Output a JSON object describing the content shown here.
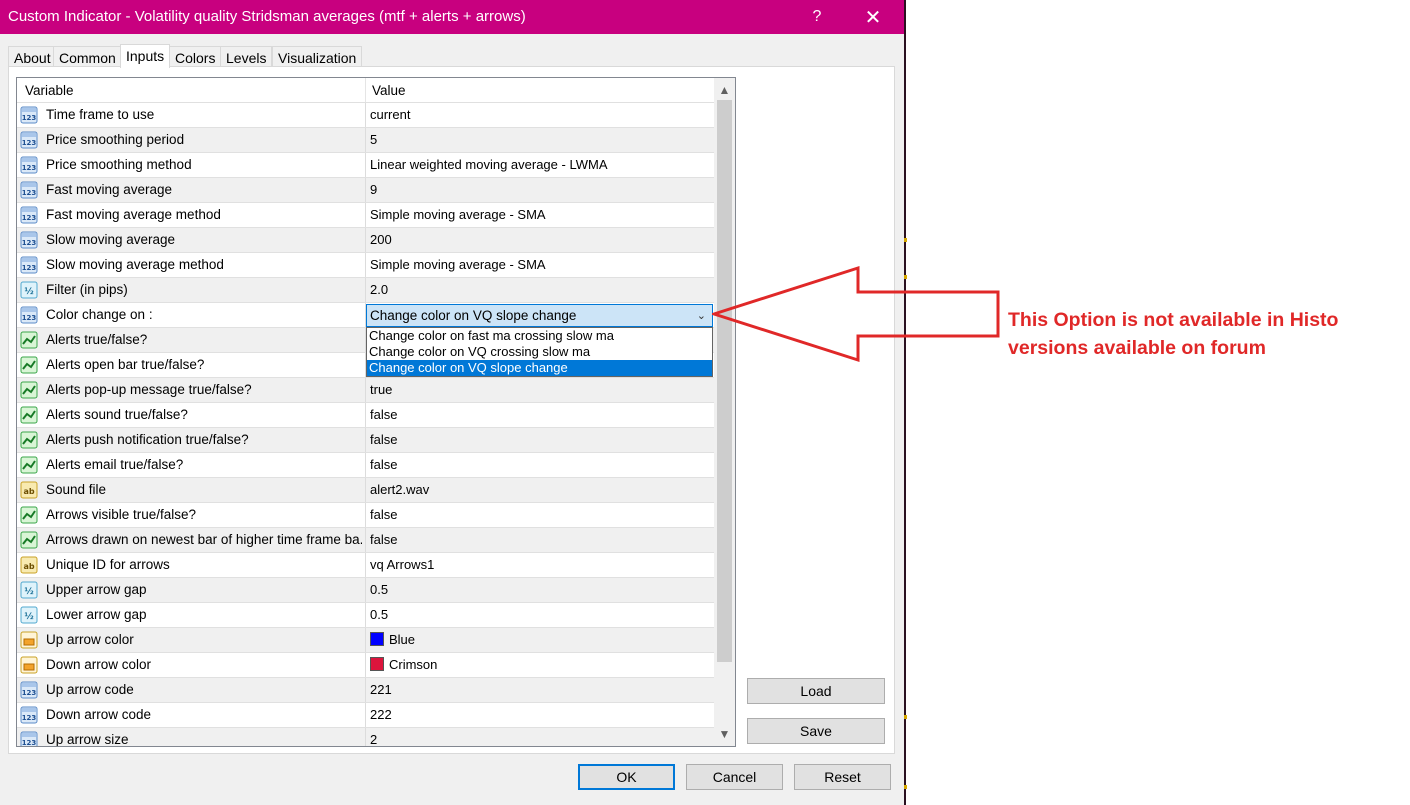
{
  "window": {
    "title": "Custom Indicator - Volatility quality Stridsman  averages (mtf + alerts + arrows)",
    "help_glyph": "?",
    "close_glyph": "✕"
  },
  "tabs": [
    {
      "label": "About"
    },
    {
      "label": "Common"
    },
    {
      "label": "Inputs",
      "active": true
    },
    {
      "label": "Colors"
    },
    {
      "label": "Levels"
    },
    {
      "label": "Visualization"
    }
  ],
  "grid": {
    "header_variable": "Variable",
    "header_value": "Value",
    "rows": [
      {
        "icon": "int-123-icon",
        "variable": "Time frame to use",
        "value": "current"
      },
      {
        "icon": "int-123-icon",
        "variable": "Price smoothing period",
        "value": "5"
      },
      {
        "icon": "int-123-icon",
        "variable": "Price smoothing method",
        "value": "Linear weighted moving average - LWMA"
      },
      {
        "icon": "int-123-icon",
        "variable": "Fast moving average",
        "value": "9"
      },
      {
        "icon": "int-123-icon",
        "variable": "Fast moving average method",
        "value": "Simple moving average - SMA"
      },
      {
        "icon": "int-123-icon",
        "variable": "Slow moving average",
        "value": "200"
      },
      {
        "icon": "int-123-icon",
        "variable": "Slow moving average method",
        "value": "Simple moving average - SMA"
      },
      {
        "icon": "double-half-icon",
        "variable": "Filter (in pips)",
        "value": "2.0"
      },
      {
        "icon": "int-123-icon",
        "variable": "Color change on :",
        "value": "Change color on VQ slope change"
      },
      {
        "icon": "bool-icon",
        "variable": "Alerts true/false?",
        "value": ""
      },
      {
        "icon": "bool-icon",
        "variable": "Alerts open bar true/false?",
        "value": ""
      },
      {
        "icon": "bool-icon",
        "variable": "Alerts pop-up message true/false?",
        "value": "true"
      },
      {
        "icon": "bool-icon",
        "variable": "Alerts sound true/false?",
        "value": "false"
      },
      {
        "icon": "bool-icon",
        "variable": "Alerts push notification true/false?",
        "value": "false"
      },
      {
        "icon": "bool-icon",
        "variable": "Alerts email true/false?",
        "value": "false"
      },
      {
        "icon": "string-ab-icon",
        "variable": "Sound file",
        "value": "alert2.wav"
      },
      {
        "icon": "bool-icon",
        "variable": "Arrows visible true/false?",
        "value": "false"
      },
      {
        "icon": "bool-icon",
        "variable": "Arrows drawn on newest bar of higher time frame ba...",
        "value": "false"
      },
      {
        "icon": "string-ab-icon",
        "variable": "Unique ID for arrows",
        "value": "vq Arrows1"
      },
      {
        "icon": "double-half-icon",
        "variable": "Upper arrow gap",
        "value": "0.5"
      },
      {
        "icon": "double-half-icon",
        "variable": "Lower arrow gap",
        "value": "0.5"
      },
      {
        "icon": "color-icon",
        "variable": "Up arrow color",
        "value": "Blue",
        "swatch": "#0000ff"
      },
      {
        "icon": "color-icon",
        "variable": "Down arrow color",
        "value": "Crimson",
        "swatch": "#dc143c"
      },
      {
        "icon": "int-123-icon",
        "variable": "Up arrow code",
        "value": "221"
      },
      {
        "icon": "int-123-icon",
        "variable": "Down arrow code",
        "value": "222"
      },
      {
        "icon": "int-123-icon",
        "variable": "Up arrow size",
        "value": "2"
      }
    ]
  },
  "dropdown": {
    "options": [
      "Change color on fast ma crossing slow ma",
      "Change color on VQ crossing slow ma",
      "Change color on VQ slope change"
    ],
    "selected": "Change color on VQ slope change"
  },
  "buttons": {
    "load": "Load",
    "save": "Save",
    "ok": "OK",
    "cancel": "Cancel",
    "reset": "Reset"
  },
  "annotation": {
    "text": "This Option is not available in Histo versions available on forum",
    "color": "#e02828"
  },
  "colors": {
    "titlebar": "#c8007f",
    "selection": "#0078d7"
  }
}
